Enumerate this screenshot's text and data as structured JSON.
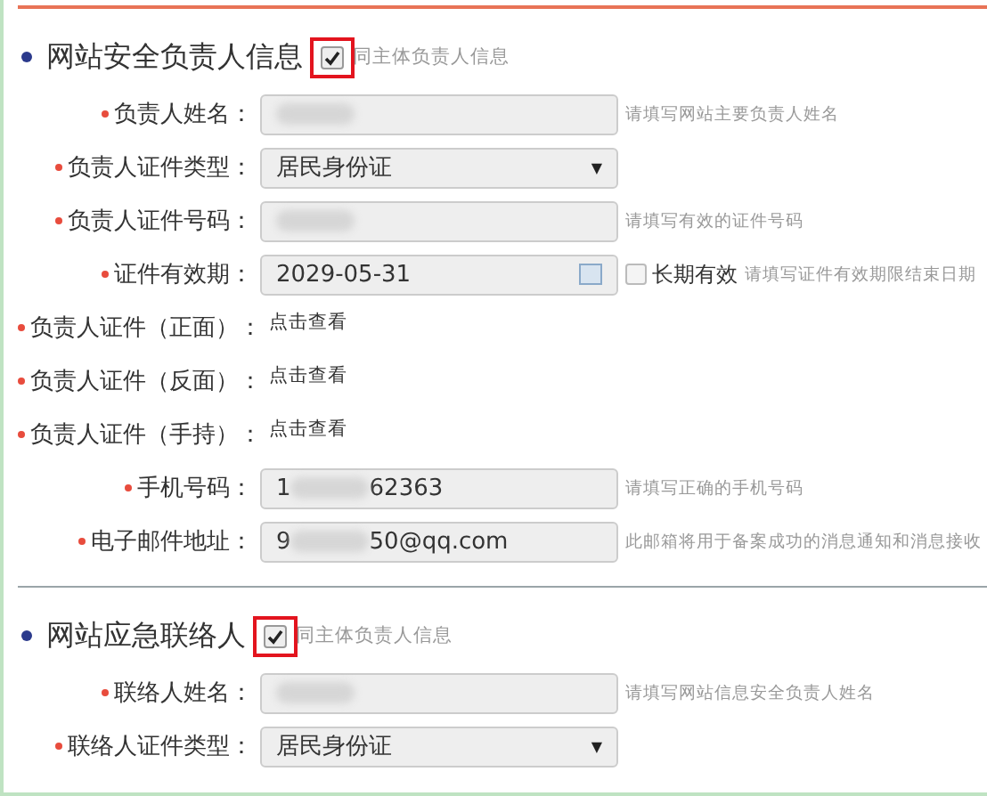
{
  "sections": [
    {
      "title": "网站安全负责人信息",
      "same_as": {
        "label": "同主体负责人信息",
        "checked": true,
        "highlighted": true
      },
      "rows": [
        {
          "kind": "text",
          "label": "负责人姓名：",
          "required": true,
          "redacted": true,
          "hint": "请填写网站主要负责人姓名"
        },
        {
          "kind": "select",
          "label": "负责人证件类型：",
          "required": true,
          "value": "居民身份证",
          "caret": "▼"
        },
        {
          "kind": "text",
          "label": "负责人证件号码：",
          "required": true,
          "redacted": true,
          "hint": "请填写有效的证件号码"
        },
        {
          "kind": "date",
          "label": "证件有效期：",
          "required": true,
          "value": "2029-05-31",
          "option": {
            "label": "长期有效",
            "checked": false
          },
          "hint": "请填写证件有效期限结束日期"
        },
        {
          "kind": "link",
          "label": "负责人证件（正面）：",
          "required": true,
          "value": "点击查看"
        },
        {
          "kind": "link",
          "label": "负责人证件（反面）：",
          "required": true,
          "value": "点击查看"
        },
        {
          "kind": "link",
          "label": "负责人证件（手持）：",
          "required": true,
          "value": "点击查看"
        },
        {
          "kind": "text",
          "label": "手机号码：",
          "required": true,
          "value": "1",
          "value_end": "62363",
          "redacted": true,
          "hint": "请填写正确的手机号码"
        },
        {
          "kind": "text",
          "label": "电子邮件地址：",
          "required": true,
          "value": "9",
          "value_end": "50@qq.com",
          "redacted": true,
          "hint": "此邮箱将用于备案成功的消息通知和消息接收"
        }
      ]
    },
    {
      "title": "网站应急联络人",
      "same_as": {
        "label": "同主体负责人信息",
        "checked": true,
        "highlighted": true
      },
      "rows": [
        {
          "kind": "text",
          "label": "联络人姓名：",
          "required": true,
          "redacted": true,
          "hint": "请填写网站信息安全负责人姓名"
        },
        {
          "kind": "select",
          "label": "联络人证件类型：",
          "required": true,
          "value": "居民身份证",
          "caret": "▼"
        }
      ]
    }
  ]
}
